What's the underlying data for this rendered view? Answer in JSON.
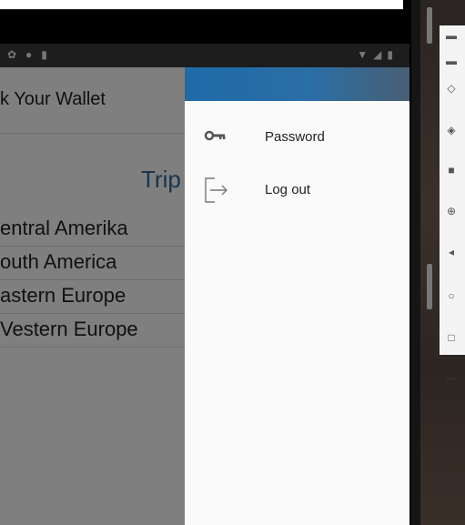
{
  "app": {
    "title": "k Your Wallet",
    "trip_heading": "Trip",
    "regions": [
      "entral Amerika",
      "outh America",
      "astern Europe",
      "Vestern Europe"
    ]
  },
  "drawer": {
    "items": [
      {
        "label": "Password",
        "icon": "key-icon"
      },
      {
        "label": "Log out",
        "icon": "logout-icon"
      }
    ]
  },
  "colors": {
    "accent": "#2e6b9e",
    "header_gradient_start": "#1f6aa8",
    "header_gradient_end": "#4a5e74"
  }
}
